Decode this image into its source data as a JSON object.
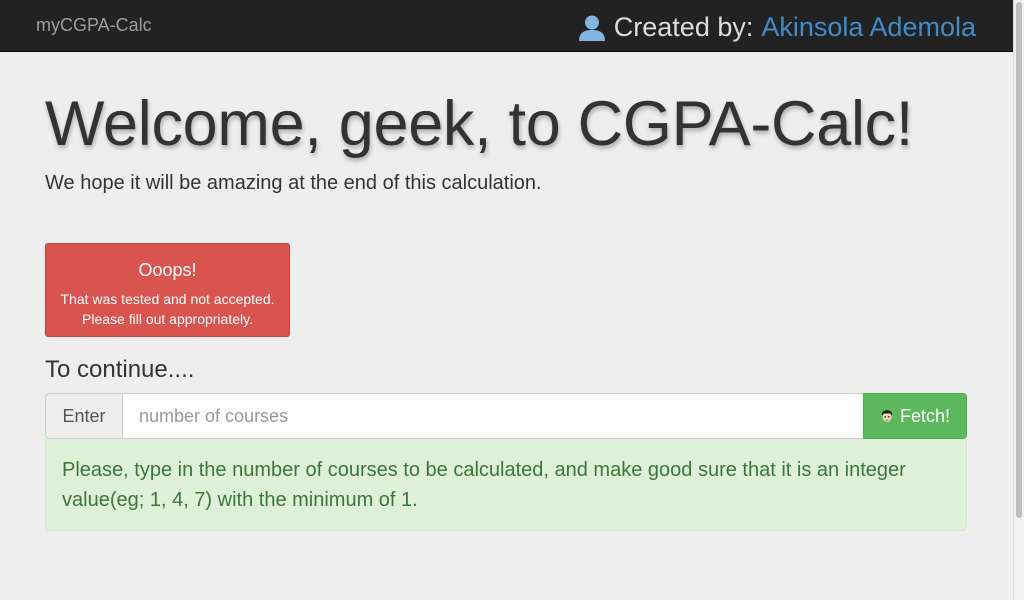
{
  "navbar": {
    "brand": "myCGPA-Calc",
    "created_by_label": "Created by:",
    "author_name": "Akinsola Ademola",
    "icons": {
      "user": "user-icon"
    }
  },
  "hero": {
    "title": "Welcome, geek, to CGPA-Calc!",
    "subtitle": "We hope it will be amazing at the end of this calculation."
  },
  "error_alert": {
    "title": "Ooops!",
    "line1": "That was tested and not accepted.",
    "line2": "Please fill out appropriately."
  },
  "form": {
    "continue_label": "To continue....",
    "addon_label": "Enter",
    "input_placeholder": "number of courses",
    "input_value": "",
    "button_label": "Fetch!",
    "button_icon": "face-icon"
  },
  "help_alert": {
    "text": "Please, type in the number of courses to be calculated, and make good sure that it is an integer value(eg; 1, 4, 7) with the minimum of 1."
  },
  "colors": {
    "navbar_bg": "#222222",
    "link": "#428bca",
    "danger": "#d9534f",
    "success_btn": "#5cb85c",
    "success_alert_bg": "#dff0d8",
    "success_alert_text": "#3c763d"
  }
}
